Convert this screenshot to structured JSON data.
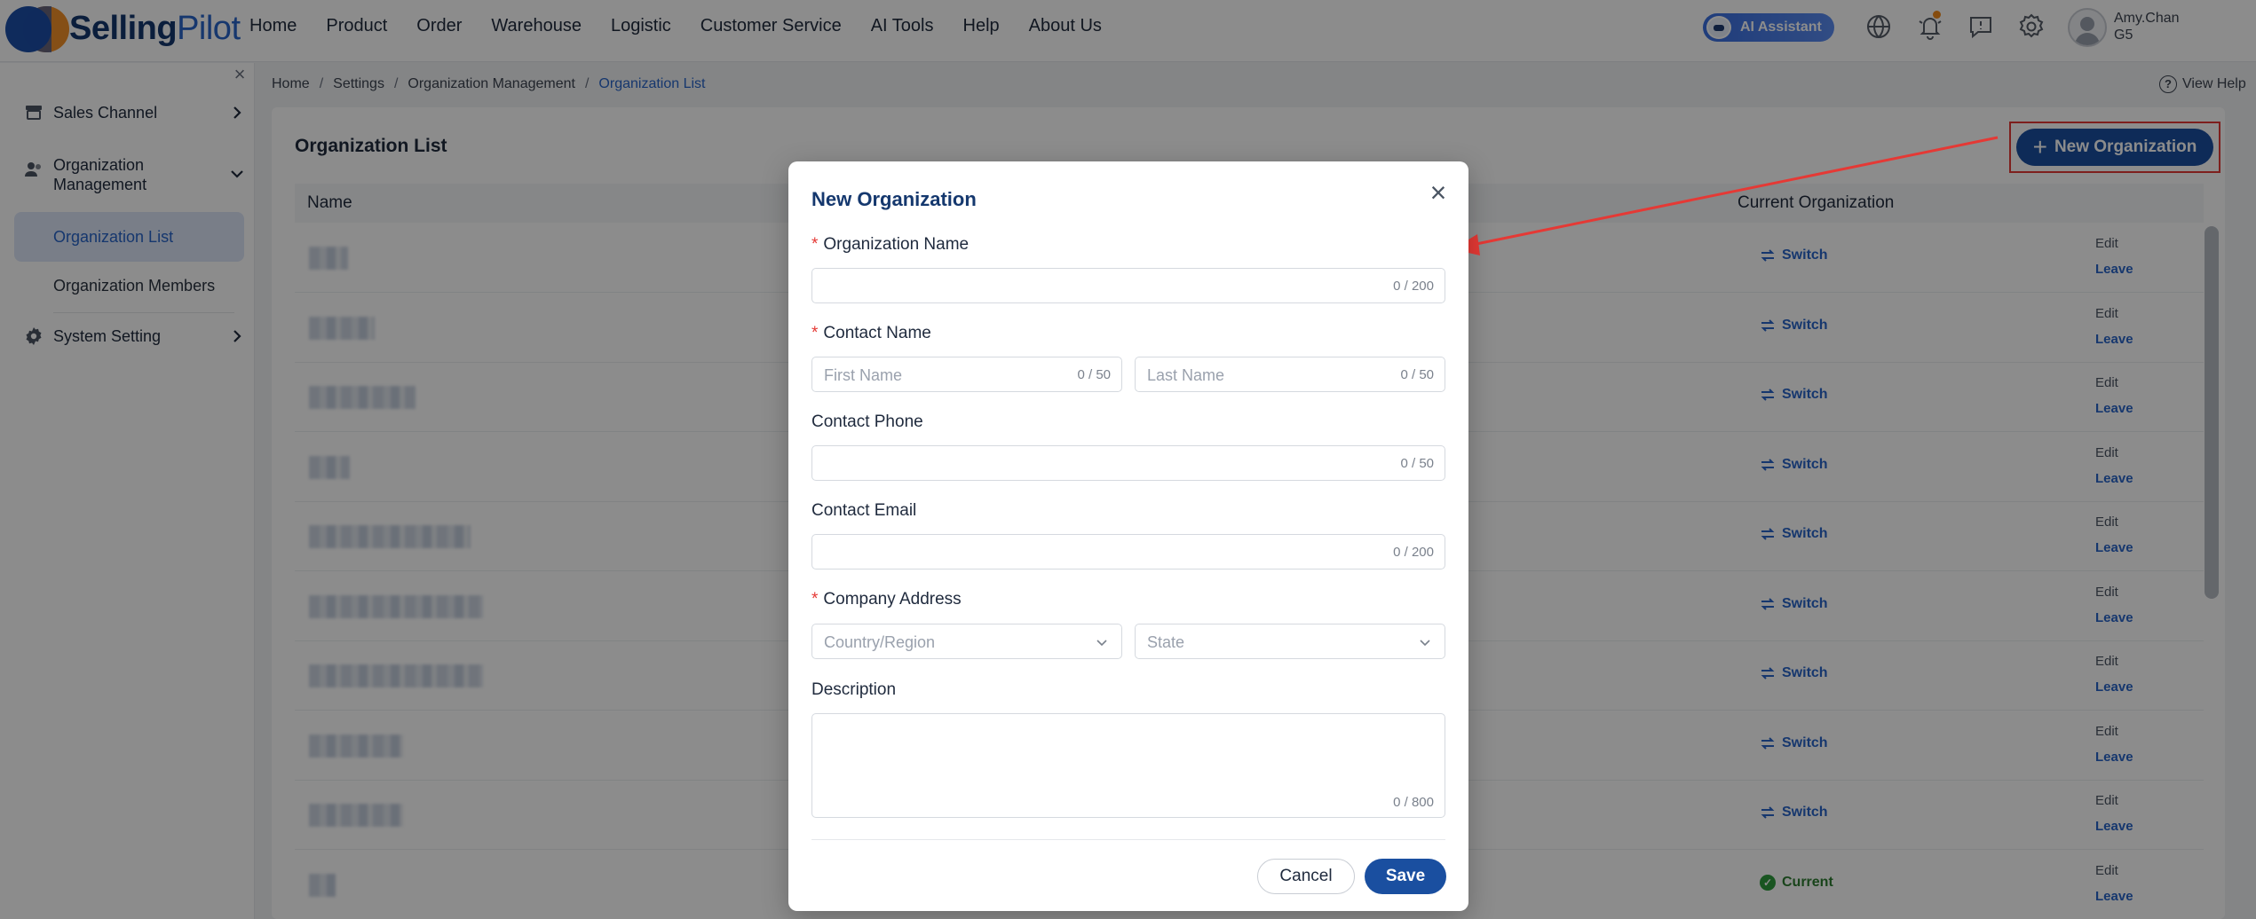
{
  "app": {
    "brand_part1": "Selling",
    "brand_part2": "Pilot"
  },
  "nav": {
    "items": [
      "Home",
      "Product",
      "Order",
      "Warehouse",
      "Logistic",
      "Customer Service",
      "AI Tools",
      "Help",
      "About Us"
    ]
  },
  "header": {
    "ai_assistant_label": "AI Assistant",
    "user_name": "Amy.Chan",
    "user_org": "G5",
    "icons": [
      "globe-icon",
      "bell-icon",
      "message-icon",
      "gear-icon",
      "avatar"
    ]
  },
  "sidebar": {
    "items": [
      {
        "label": "Sales Channel",
        "icon": "store-icon"
      },
      {
        "label": "Organization Management",
        "icon": "users-icon"
      },
      {
        "label": "System Setting",
        "icon": "gear-icon"
      }
    ],
    "subitems": [
      {
        "label": "Organization List",
        "active": true
      },
      {
        "label": "Organization Members",
        "active": false
      }
    ]
  },
  "breadcrumb": {
    "items": [
      "Home",
      "Settings",
      "Organization Management",
      "Organization List"
    ],
    "view_help": "View Help"
  },
  "page": {
    "title": "Organization List",
    "new_button": "New Organization",
    "columns": {
      "name": "Name",
      "current_org": "Current Organization"
    },
    "row_action_switch": "Switch",
    "row_action_current": "Current",
    "row_action_edit": "Edit",
    "row_action_leave": "Leave",
    "rows": [
      {
        "status": "switch"
      },
      {
        "status": "switch"
      },
      {
        "status": "switch"
      },
      {
        "status": "switch"
      },
      {
        "status": "switch"
      },
      {
        "status": "switch"
      },
      {
        "status": "switch"
      },
      {
        "status": "switch"
      },
      {
        "status": "switch"
      },
      {
        "status": "current"
      }
    ]
  },
  "modal": {
    "title": "New Organization",
    "org_name_label": "Organization Name",
    "org_name_count": "0 / 200",
    "contact_name_label": "Contact Name",
    "first_name_placeholder": "First Name",
    "first_name_count": "0 / 50",
    "last_name_placeholder": "Last Name",
    "last_name_count": "0 / 50",
    "contact_phone_label": "Contact Phone",
    "contact_phone_count": "0 / 50",
    "contact_email_label": "Contact Email",
    "contact_email_count": "0 / 200",
    "company_address_label": "Company Address",
    "country_placeholder": "Country/Region",
    "state_placeholder": "State",
    "description_label": "Description",
    "description_count": "0 / 800",
    "cancel_label": "Cancel",
    "save_label": "Save"
  },
  "colors": {
    "primary": "#1a4fa0",
    "link": "#2864c8",
    "required": "#e53935",
    "highlight_box": "#e53935",
    "success": "#2e7d32",
    "brand_orange": "#f28a1c"
  }
}
